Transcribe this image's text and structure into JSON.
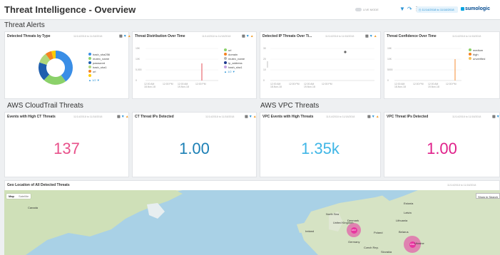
{
  "dashboard": {
    "title": "Threat Intelligence - Overview"
  },
  "topbar": {
    "live_mode": "LIVE MODE",
    "time_range": "11/14/2018 to 11/18/2018",
    "logo": "sumologic"
  },
  "sections": {
    "threat_alerts": "Threat Alerts",
    "cloudtrail": "AWS CloudTrail Threats",
    "vpc": "AWS VPC Threats"
  },
  "panels": {
    "detected_by_type": {
      "title": "Detected Threats by Type",
      "range": "11/14/2018 to 11/18/2018",
      "legend": [
        {
          "label": "hash_sha256",
          "color": "#3a8ee6"
        },
        {
          "label": "mutex_name",
          "color": "#8bd16a"
        },
        {
          "label": "password",
          "color": "#1f5fae"
        },
        {
          "label": "hash_sha1",
          "color": "#b0d77a"
        },
        {
          "label": "url",
          "color": "#f58220"
        },
        {
          "label": "",
          "color": "#ffcc00"
        }
      ],
      "pager": "1/2"
    },
    "distribution_over_time": {
      "title": "Threat Distribution Over Time",
      "range": "11/14/2018 to 11/18/2018",
      "legend": [
        {
          "label": "url",
          "color": "#8bd16a"
        },
        {
          "label": "domain",
          "color": "#f58220"
        },
        {
          "label": "mutex_name",
          "color": "#b6b6b6"
        },
        {
          "label": "ip_address",
          "color": "#1f3b8f"
        },
        {
          "label": "hash_sha1",
          "color": "#c4a2e0"
        }
      ],
      "pager": "1/2",
      "y_ticks": [
        "15K",
        "10K",
        "5,000",
        "0"
      ],
      "x_ticks": [
        "12:00 AM\n18-Nov-18",
        "12:00 PM",
        "12:00 AM\n19-Nov-18",
        "12:00 PM"
      ]
    },
    "detected_ip_over_time": {
      "title": "Detected IP Threats Over Ti...",
      "range": "11/14/2018 to 11/18/2018",
      "y_ticks": [
        "30",
        "20",
        "10",
        "0"
      ],
      "x_ticks": [
        "12:00 AM\n18-Nov-18",
        "12:00 PM",
        "12:00 AM\n19-Nov-18",
        "12:00 PM"
      ]
    },
    "confidence_over_time": {
      "title": "Threat Confidence Over Time",
      "range": "11/14/2018 to 11/18/2018",
      "legend": [
        {
          "label": "medium",
          "color": "#8bd16a"
        },
        {
          "label": "high",
          "color": "#f58220"
        },
        {
          "label": "unverified",
          "color": "#f5c35a"
        }
      ],
      "y_ticks": [
        "15K",
        "10K",
        "5000",
        "0"
      ],
      "x_ticks": [
        "12:00 AM\n18-Nov-18",
        "12:00 PM",
        "12:00 AM\n19-Nov-18",
        "12:00 PM"
      ]
    },
    "events_high_ct": {
      "title": "Events with High CT Threats",
      "range": "11/14/2018 to 11/18/2018",
      "value": "137",
      "color": "#e8508a"
    },
    "ct_ips_detected": {
      "title": "CT Threat IPs Detected",
      "range": "11/14/2018 to 11/18/2018",
      "value": "1.00",
      "color": "#1b7fb5"
    },
    "vpc_events_high": {
      "title": "VPC Events with High Threats",
      "range": "11/14/2018 to 11/18/2018",
      "value": "1.35k",
      "color": "#3fb6e6"
    },
    "vpc_ips_detected": {
      "title": "VPC Threat IPs Detected",
      "range": "11/14/2018 to 11/18/2018",
      "value": "1.00",
      "color": "#e0208a"
    },
    "geo": {
      "title": "Geo Location of All Detected Threats",
      "range": "11/14/2018 to 11/18/2018",
      "map_tabs": [
        "Map",
        "Satellite"
      ],
      "show_in_search": "Show in Search",
      "labels": [
        "Canada",
        "North Sea",
        "United Kingdom",
        "Ireland",
        "Denmark",
        "Latvia",
        "Lithuania",
        "Estonia",
        "Poland",
        "Belarus",
        "Germany",
        "Czech Rep.",
        "Ukraine",
        "Slovakia"
      ],
      "clusters": [
        "1867",
        "1563"
      ]
    }
  },
  "chart_data": [
    {
      "type": "pie",
      "title": "Detected Threats by Type",
      "categories": [
        "hash_sha256",
        "mutex_name",
        "password",
        "hash_sha1",
        "url",
        "other"
      ],
      "values": [
        40,
        22,
        18,
        10,
        6,
        4
      ]
    }
  ]
}
